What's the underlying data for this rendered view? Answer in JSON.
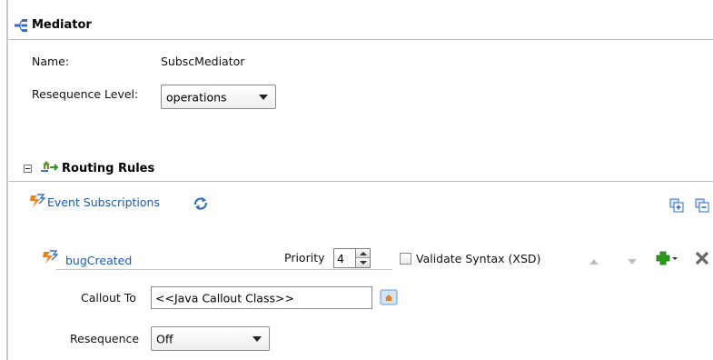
{
  "mediator": {
    "title": "Mediator",
    "name_label": "Name:",
    "name_value": "SubscMediator",
    "resequence_label": "Resequence Level:",
    "resequence_value": "operations"
  },
  "routing": {
    "title": "Routing Rules",
    "event_subscriptions_link": "Event Subscriptions"
  },
  "rule": {
    "event_name": "bugCreated",
    "priority_label": "Priority",
    "priority_value": "4",
    "validate_label": "Validate Syntax (XSD)",
    "callout_label": "Callout To",
    "callout_value": "<<Java Callout Class>>",
    "resequence_label": "Resequence",
    "resequence_value": "Off"
  },
  "icons": {
    "mediator": "mediator-icon",
    "routing": "routing-rules-icon",
    "event": "lightning-event-icon",
    "refresh": "refresh-subscriptions-icon",
    "add_rule": "add-rule-icon",
    "remove_rule": "remove-rule-icon",
    "move_up": "move-up-icon",
    "move_down": "move-down-icon",
    "add_case": "add-icon",
    "delete": "delete-icon",
    "browse": "browse-class-icon"
  },
  "colors": {
    "link": "#1c5bb5",
    "add_green": "#2c9a1c",
    "event_orange": "#e8821e"
  }
}
